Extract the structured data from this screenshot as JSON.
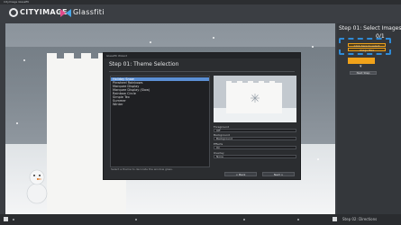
{
  "window": {
    "title": "CityImage Glassfiti"
  },
  "header": {
    "brand": "CITYIMAGE",
    "product": "Glassfiti"
  },
  "dialog": {
    "window_title": "Glassfiti Wizard",
    "heading": "Step 01: Theme Selection",
    "themes": [
      "Holiday Snow",
      "Pinwheel Rainbows",
      "Marquee Display",
      "Marquee Display (Slow)",
      "Rainbow Circle",
      "Simple Tex",
      "Summer",
      "Winter"
    ],
    "selected_theme": "Holiday Snow",
    "properties": [
      {
        "label": "Foreground",
        "value": "Off"
      },
      {
        "label": "Background",
        "value": "Background"
      },
      {
        "label": "Effects",
        "value": "On"
      },
      {
        "label": "Overlay",
        "value": "None"
      }
    ],
    "hint": "Select a theme to decorate the window glass.",
    "back_label": "< Back",
    "next_label": "Next >"
  },
  "side_panel": {
    "title": "Step 01: Select Images",
    "counter": "0/1",
    "highlight_lines": [
      "Click here to select",
      "image files"
    ],
    "arrow": "▾",
    "next_button": "Next Step"
  },
  "status": {
    "step_label": "Step 02: Directions"
  },
  "colors": {
    "accent": "#2f8bd6",
    "highlight": "#f0a21a",
    "selection": "#5b8fd4"
  }
}
